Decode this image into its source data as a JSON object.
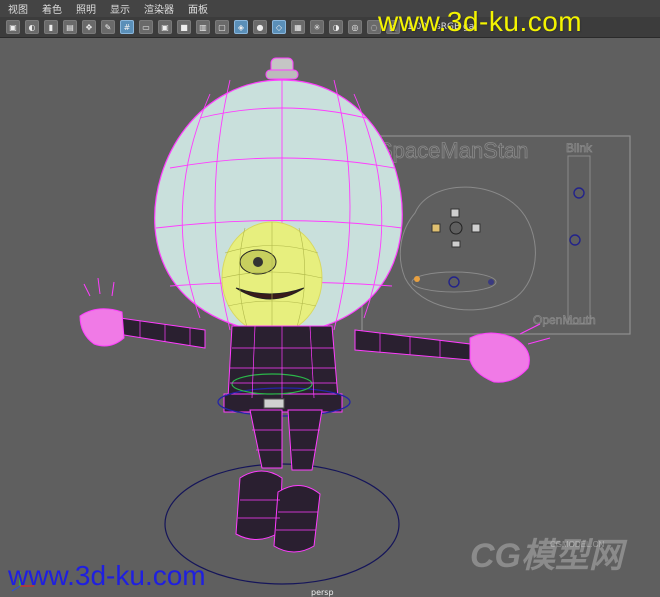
{
  "menu": {
    "items": [
      "视图",
      "着色",
      "照明",
      "显示",
      "渲染器",
      "面板"
    ]
  },
  "toolbar": {
    "field_value": "1.00",
    "field_suffix": "sRGB ga"
  },
  "viewport": {
    "camera": "persp"
  },
  "rig_panel": {
    "title": "SpaceManStan",
    "blink": "Blink",
    "open_mouth": "OpenMouth"
  },
  "watermarks": {
    "top": "www.3d-ku.com",
    "bottom": "www.3d-ku.com",
    "cg": "CG模型网",
    "cg_sub": "CGMODEL.CN"
  },
  "colors": {
    "wire_magenta": "#ff3cff",
    "helmet": "#c9e0dc",
    "face": "#e7ef7e",
    "body": "#2a2030",
    "accent_blue": "#5a8fb8"
  },
  "icons": [
    "camera-icon",
    "bookmark-icon",
    "image-plane-icon",
    "grid-icon",
    "wireframe-icon",
    "smooth-shade-icon",
    "textured-icon",
    "lights-icon",
    "shadows-icon",
    "xray-icon"
  ]
}
